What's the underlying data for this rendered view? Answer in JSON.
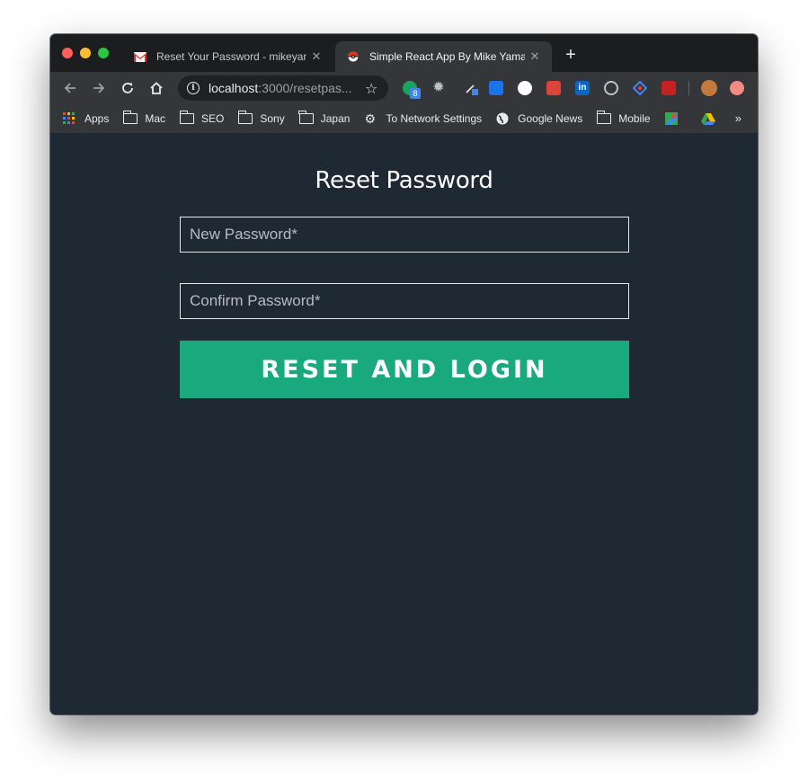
{
  "tabs": [
    {
      "title": "Reset Your Password - mikeyamato",
      "favicon": "gmail-icon",
      "active": false
    },
    {
      "title": "Simple React App By Mike Yamato",
      "favicon": "pokeball-icon",
      "active": true
    }
  ],
  "newtab": "+",
  "address": {
    "host": "localhost",
    "path": ":3000/resetpas..."
  },
  "bookmarks": [
    {
      "label": "Apps",
      "icon": "apps-grid-icon"
    },
    {
      "label": "Mac",
      "icon": "folder-icon"
    },
    {
      "label": "SEO",
      "icon": "folder-icon"
    },
    {
      "label": "Sony",
      "icon": "folder-icon"
    },
    {
      "label": "Japan",
      "icon": "folder-icon"
    },
    {
      "label": "To Network Settings",
      "icon": "gear-icon"
    },
    {
      "label": "Google News",
      "icon": "globe-icon"
    },
    {
      "label": "Mobile",
      "icon": "folder-icon"
    }
  ],
  "extension_badge": "8",
  "more_bookmarks": "»",
  "form": {
    "heading": "Reset Password",
    "new_password_placeholder": "New Password*",
    "confirm_password_placeholder": "Confirm Password*",
    "submit_label": "RESET AND LOGIN"
  },
  "colors": {
    "page_background": "#1f2933",
    "button": "#19a97c"
  }
}
